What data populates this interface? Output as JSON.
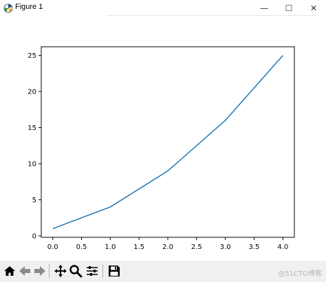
{
  "window": {
    "title": "Figure 1",
    "minimize_glyph": "—",
    "maximize_glyph": "☐",
    "close_glyph": "✕",
    "app_icon": "matplotlib-logo-icon"
  },
  "toolbar": {
    "buttons": [
      {
        "name": "home-icon"
      },
      {
        "name": "back-arrow-icon"
      },
      {
        "name": "forward-arrow-icon"
      },
      {
        "name": "pan-icon"
      },
      {
        "name": "zoom-icon"
      },
      {
        "name": "configure-subplots-icon"
      },
      {
        "name": "save-icon"
      }
    ],
    "watermark": "@51CTO博客"
  },
  "chart_data": {
    "type": "line",
    "x": [
      0,
      1,
      2,
      3,
      4
    ],
    "series": [
      {
        "values": [
          1,
          4,
          9,
          16,
          25
        ],
        "color": "#1f77b4"
      }
    ],
    "xlim": [
      -0.2,
      4.2
    ],
    "ylim": [
      -0.2,
      26.2
    ],
    "xticks": [
      "0.0",
      "0.5",
      "1.0",
      "1.5",
      "2.0",
      "2.5",
      "3.0",
      "3.5",
      "4.0"
    ],
    "yticks": [
      "0",
      "5",
      "10",
      "15",
      "20",
      "25"
    ],
    "title": "",
    "xlabel": "",
    "ylabel": "",
    "grid": false,
    "legend": false
  }
}
